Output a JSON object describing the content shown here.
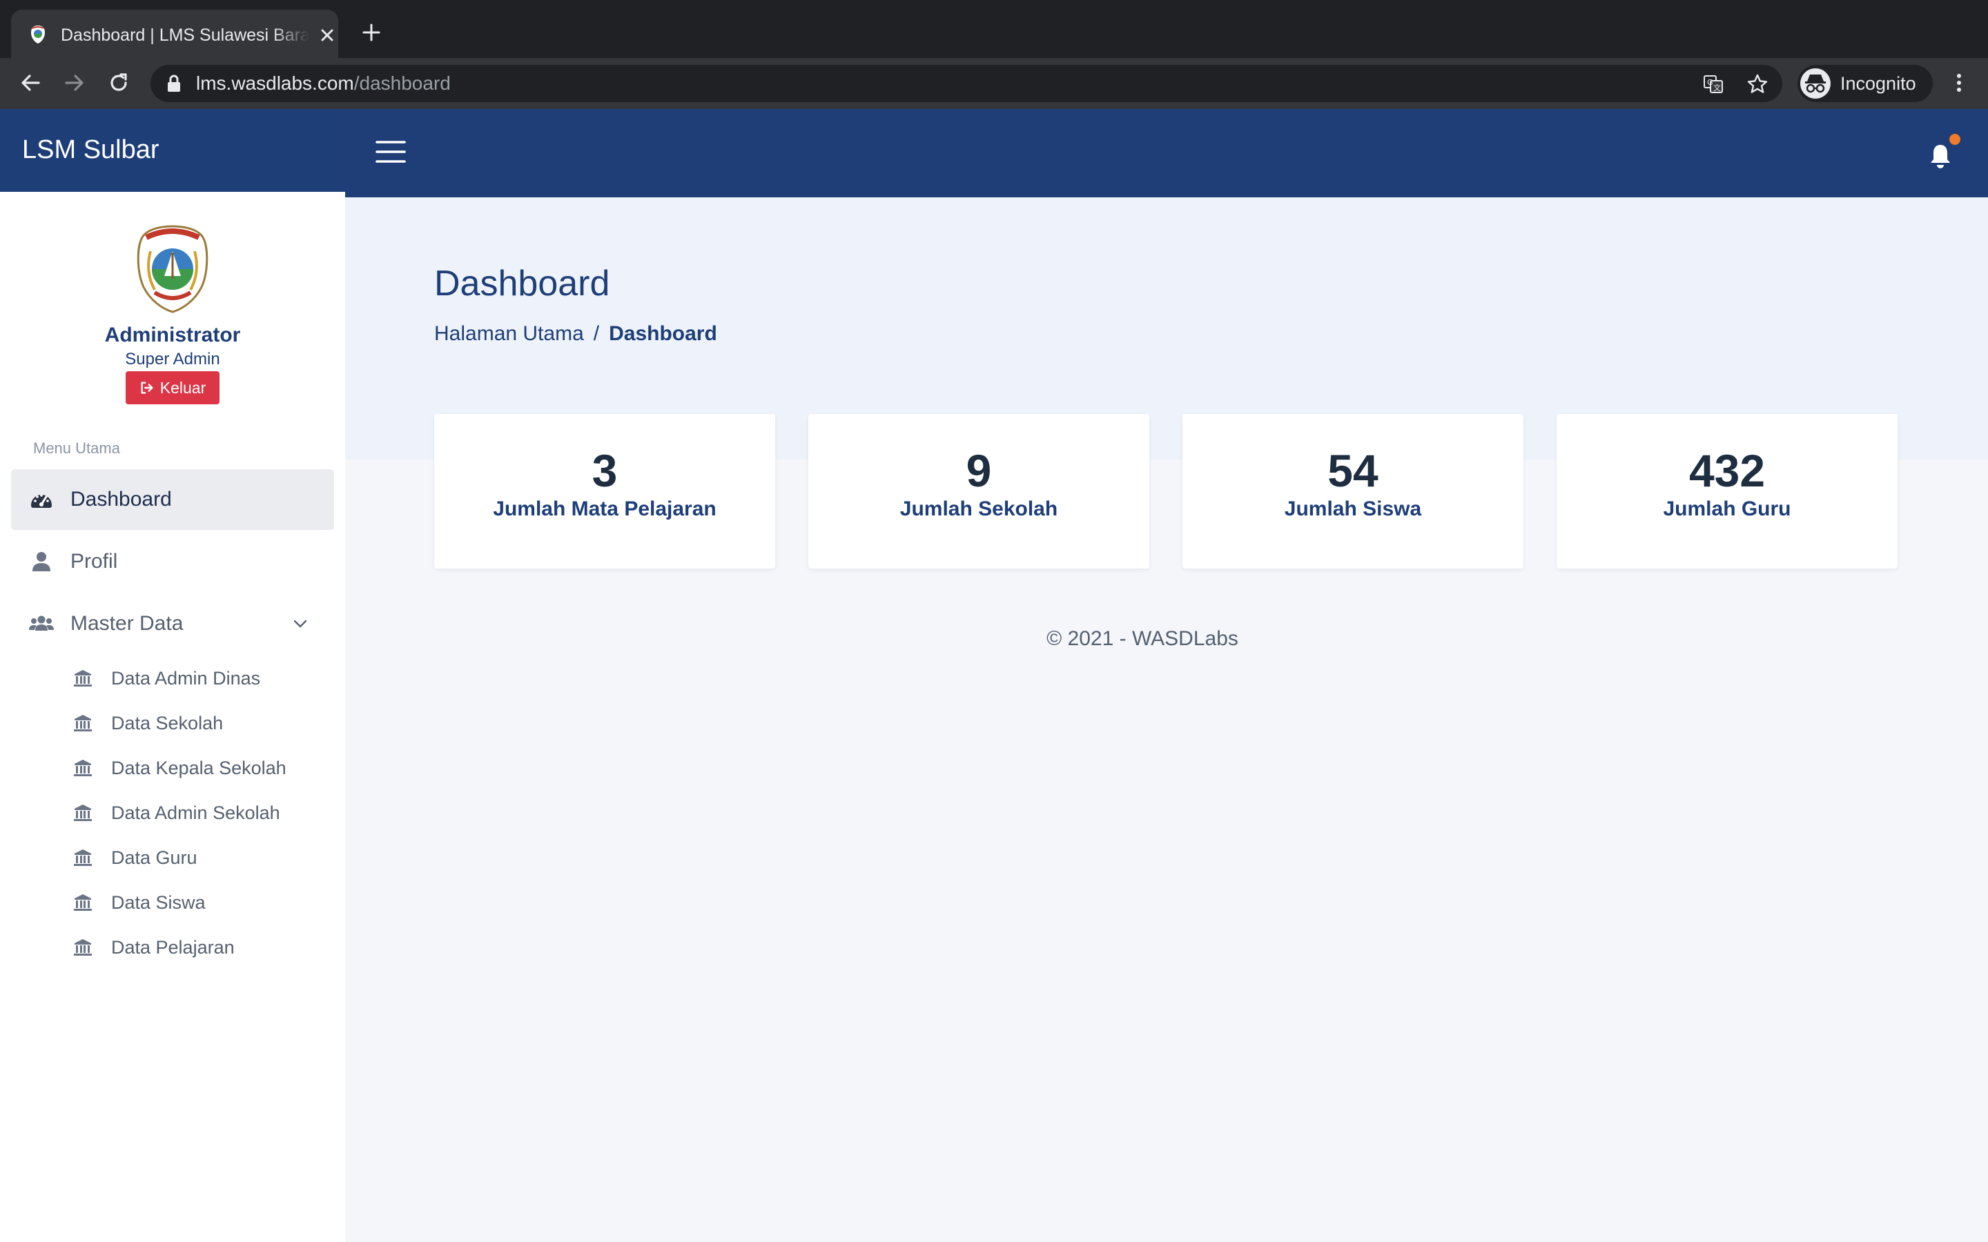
{
  "browser": {
    "tab_title": "Dashboard | LMS Sulawesi Barat",
    "url_host": "lms.wasdlabs.com",
    "url_path": "/dashboard",
    "profile_label": "Incognito"
  },
  "app": {
    "brand": "LSM Sulbar"
  },
  "user": {
    "name": "Administrator",
    "role": "Super Admin",
    "logout_label": "Keluar"
  },
  "sidebar": {
    "heading": "Menu Utama",
    "items": [
      {
        "label": "Dashboard",
        "icon": "tachometer-icon",
        "active": true
      },
      {
        "label": "Profil",
        "icon": "user-icon",
        "active": false
      },
      {
        "label": "Master Data",
        "icon": "users-icon",
        "active": false,
        "expanded": true
      }
    ],
    "sub_items": [
      {
        "label": "Data Admin Dinas",
        "icon": "institution-icon"
      },
      {
        "label": "Data Sekolah",
        "icon": "institution-icon"
      },
      {
        "label": "Data Kepala Sekolah",
        "icon": "institution-icon"
      },
      {
        "label": "Data Admin Sekolah",
        "icon": "institution-icon"
      },
      {
        "label": "Data Guru",
        "icon": "institution-icon"
      },
      {
        "label": "Data Siswa",
        "icon": "institution-icon"
      },
      {
        "label": "Data Pelajaran",
        "icon": "institution-icon"
      }
    ]
  },
  "page": {
    "title": "Dashboard",
    "breadcrumb": {
      "home": "Halaman Utama",
      "separator": "/",
      "current": "Dashboard"
    }
  },
  "stats": [
    {
      "value": "3",
      "label": "Jumlah Mata Pelajaran"
    },
    {
      "value": "9",
      "label": "Jumlah Sekolah"
    },
    {
      "value": "54",
      "label": "Jumlah Siswa"
    },
    {
      "value": "432",
      "label": "Jumlah Guru"
    }
  ],
  "footer": {
    "text": "© 2021 - WASDLabs"
  },
  "colors": {
    "primary": "#1e3e78",
    "danger": "#dc3545",
    "notification_dot": "#f07b2a",
    "background": "#f4f6fa"
  }
}
